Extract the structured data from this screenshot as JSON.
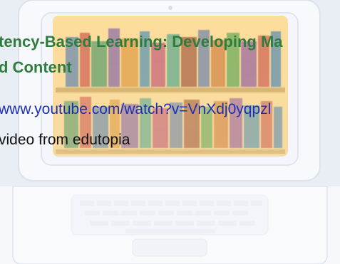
{
  "page": {
    "title_line1": "tency-Based Learning: Developing Ma",
    "title_line2": "d Content",
    "video_link": "www.youtube.com/watch?v=VnXdj0yqpzl",
    "caption": "video from edutopia"
  },
  "colors": {
    "background": "#e9eef4",
    "laptop_shell": "#f6f8fb",
    "laptop_outline": "#dfe5ec",
    "screen_top": "#ffd57d",
    "screen_bottom": "#e6eef7",
    "title": "#2f7d3e",
    "link": "#1e2fb7",
    "text": "#111111"
  },
  "icons": {
    "background_illustration": "laptop-with-bookshelf-icon"
  }
}
